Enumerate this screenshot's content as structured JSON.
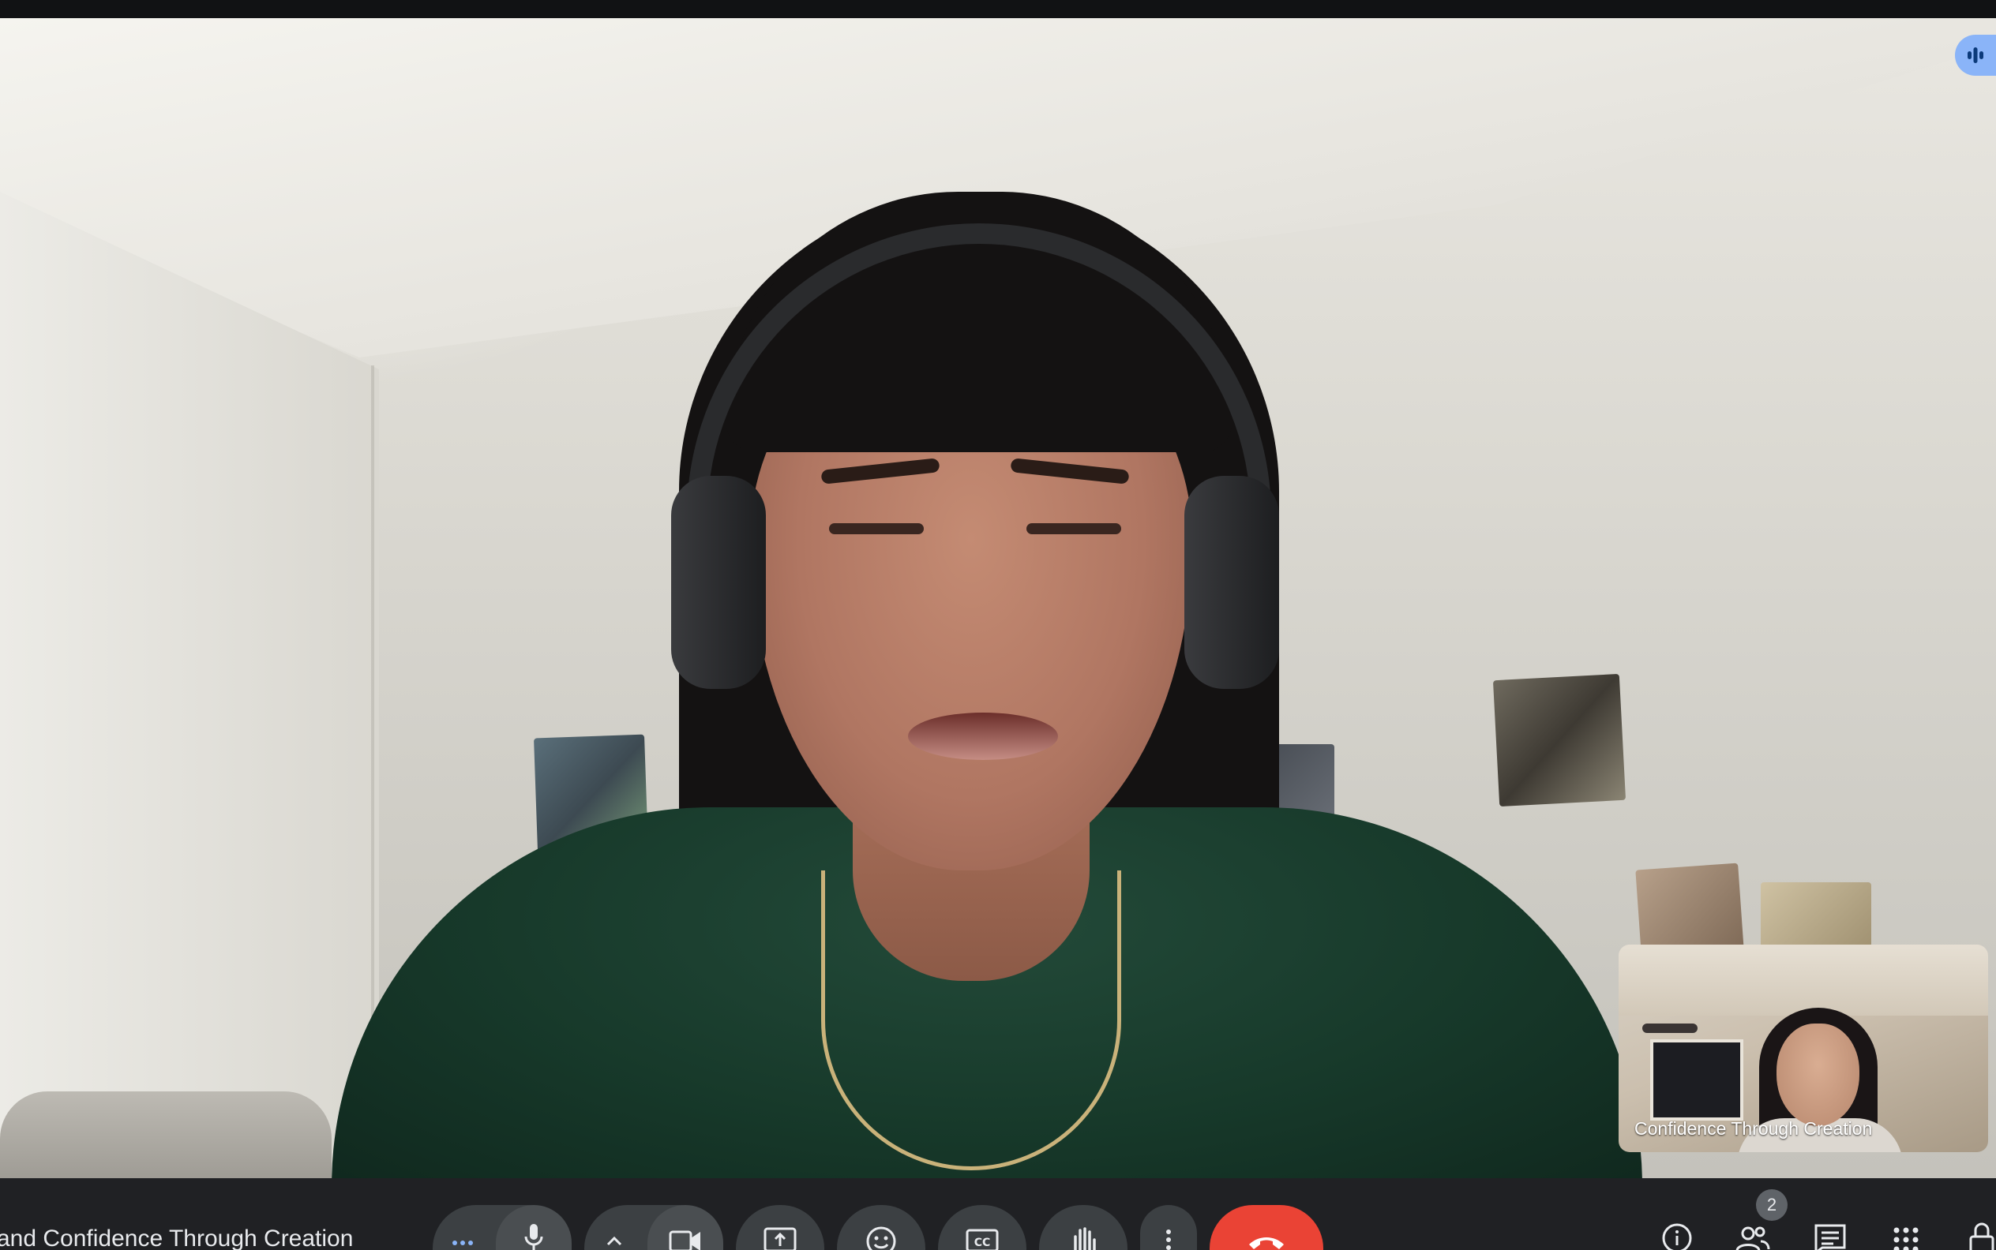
{
  "meeting": {
    "title": "and Confidence Through Creation",
    "participant_count": "2"
  },
  "self_view": {
    "name": "Confidence Through Creation"
  },
  "controls": {
    "icons": [
      "more-options-icon",
      "microphone-icon",
      "chevron-up-icon",
      "camera-icon",
      "present-screen-icon",
      "emoji-icon",
      "captions-icon",
      "raise-hand-icon",
      "vertical-dots-icon",
      "end-call-icon"
    ],
    "end_call_color": "#ea4335"
  },
  "side_panel": {
    "icons": [
      "info-icon",
      "people-icon",
      "chat-icon",
      "activities-icon",
      "host-controls-icon"
    ]
  },
  "colors": {
    "bar_background": "#202124",
    "button_background": "#3c4043",
    "speaking_indicator": "#8ab4f8"
  }
}
